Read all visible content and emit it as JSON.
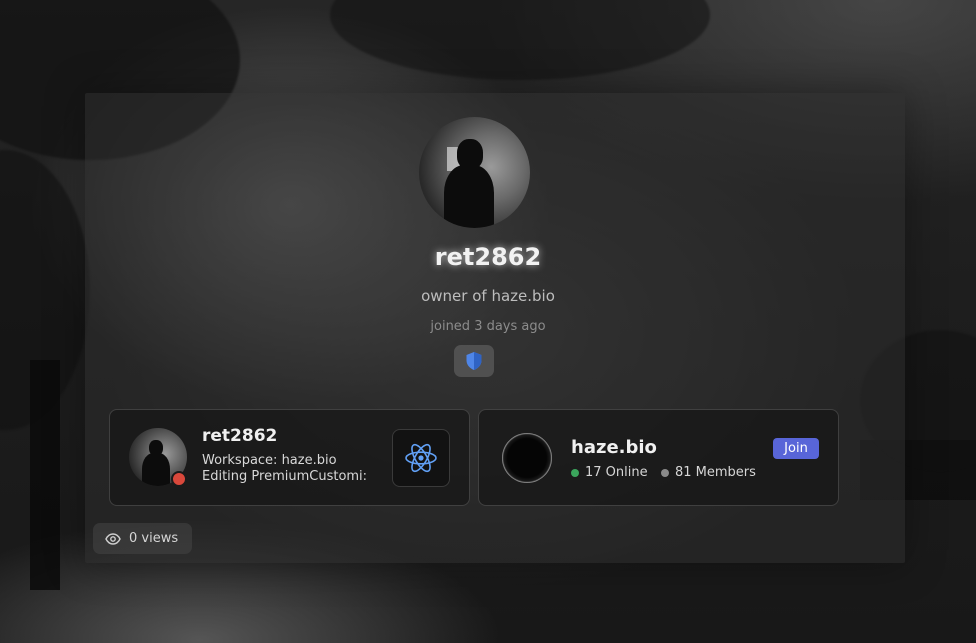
{
  "profile": {
    "username": "ret2862",
    "bio": "owner of haze.bio",
    "joined": "joined 3 days ago",
    "badge_icon": "shield-icon"
  },
  "discord_presence": {
    "username": "ret2862",
    "status": "dnd",
    "status_color": "#d9483b",
    "activity_line1": "Workspace: haze.bio",
    "activity_line2": "Editing PremiumCustomi:",
    "activity_icon": "react-icon"
  },
  "server": {
    "name": "haze.bio",
    "join_label": "Join",
    "online": "17 Online",
    "members": "81 Members",
    "online_color": "#3ba55c",
    "members_color": "#8a8a8a",
    "join_color": "#5865d8"
  },
  "views": {
    "label": "0 views",
    "icon": "eye-icon"
  }
}
